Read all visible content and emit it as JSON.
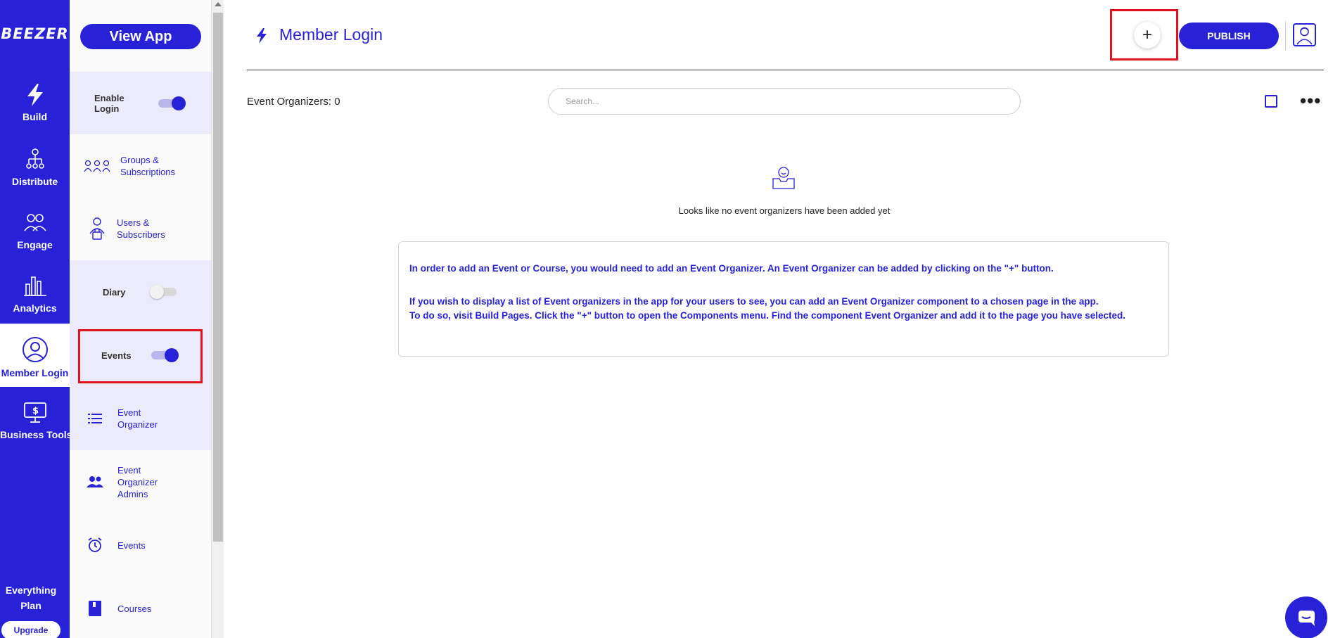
{
  "rail": {
    "logo": "BEEZER",
    "items": [
      {
        "label": "Build",
        "icon": "bolt-icon"
      },
      {
        "label": "Distribute",
        "icon": "network-icon"
      },
      {
        "label": "Engage",
        "icon": "people-icon"
      },
      {
        "label": "Analytics",
        "icon": "bar-chart-icon"
      },
      {
        "label": "Member Login",
        "icon": "user-circle-icon",
        "active": true
      },
      {
        "label": "Business Tools",
        "icon": "dollar-monitor-icon"
      }
    ],
    "plan_line1": "Everything",
    "plan_line2": "Plan",
    "upgrade_label": "Upgrade"
  },
  "panel": {
    "view_app_label": "View App",
    "enable_login_line1": "Enable",
    "enable_login_line2": "Login",
    "enable_login_on": true,
    "groups_line1": "Groups &",
    "groups_line2": "Subscriptions",
    "users_line1": "Users &",
    "users_line2": "Subscribers",
    "diary_label": "Diary",
    "diary_on": false,
    "events_label": "Events",
    "events_on": true,
    "event_organizer_line1": "Event",
    "event_organizer_line2": "Organizer",
    "eo_admins_line1": "Event",
    "eo_admins_line2": "Organizer",
    "eo_admins_line3": "Admins",
    "events_item": "Events",
    "courses_item": "Courses"
  },
  "header": {
    "title": "Member Login",
    "add_label": "+",
    "publish_label": "PUBLISH"
  },
  "toolbar": {
    "count_text": "Event Organizers: 0",
    "search_placeholder": "Search..."
  },
  "empty_state": {
    "message": "Looks like no event organizers have been added yet"
  },
  "info": {
    "line1": "In order to add an Event or Course, you would need to add an Event Organizer. An Event Organizer can be added by clicking on the \"+\" button.",
    "line2": "If you wish to display a list of Event organizers in the app for your users to see, you can add an Event Organizer component to a chosen page in the app.",
    "line3": "To do so, visit Build Pages. Click the \"+\" button to open the Components menu. Find the component Event Organizer and add it to the page you have selected."
  },
  "colors": {
    "brand": "#2722d8",
    "highlight": "#e0121b",
    "panel_shade": "#ecebfb"
  }
}
